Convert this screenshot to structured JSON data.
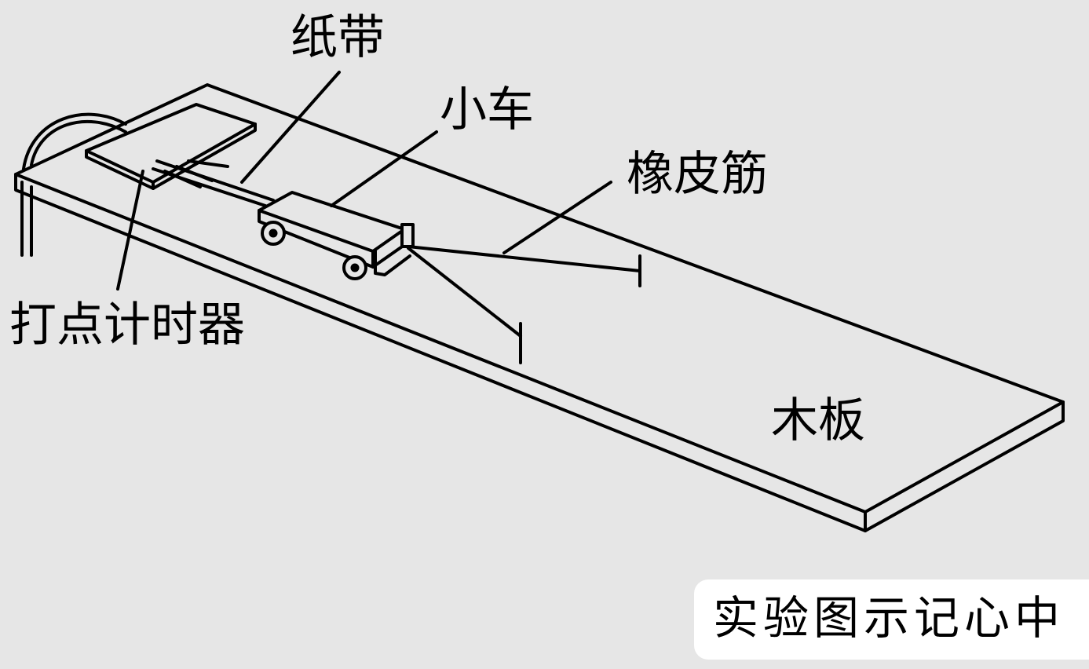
{
  "labels": {
    "paper_tape": "纸带",
    "cart": "小车",
    "rubber_band": "橡皮筋",
    "timer": "打点计时器",
    "board": "木板"
  },
  "watermark": {
    "text": "实验图示记心中"
  },
  "colors": {
    "background": "#e6e6e6",
    "ink": "#000000",
    "watermark_background": "#ffffff"
  }
}
